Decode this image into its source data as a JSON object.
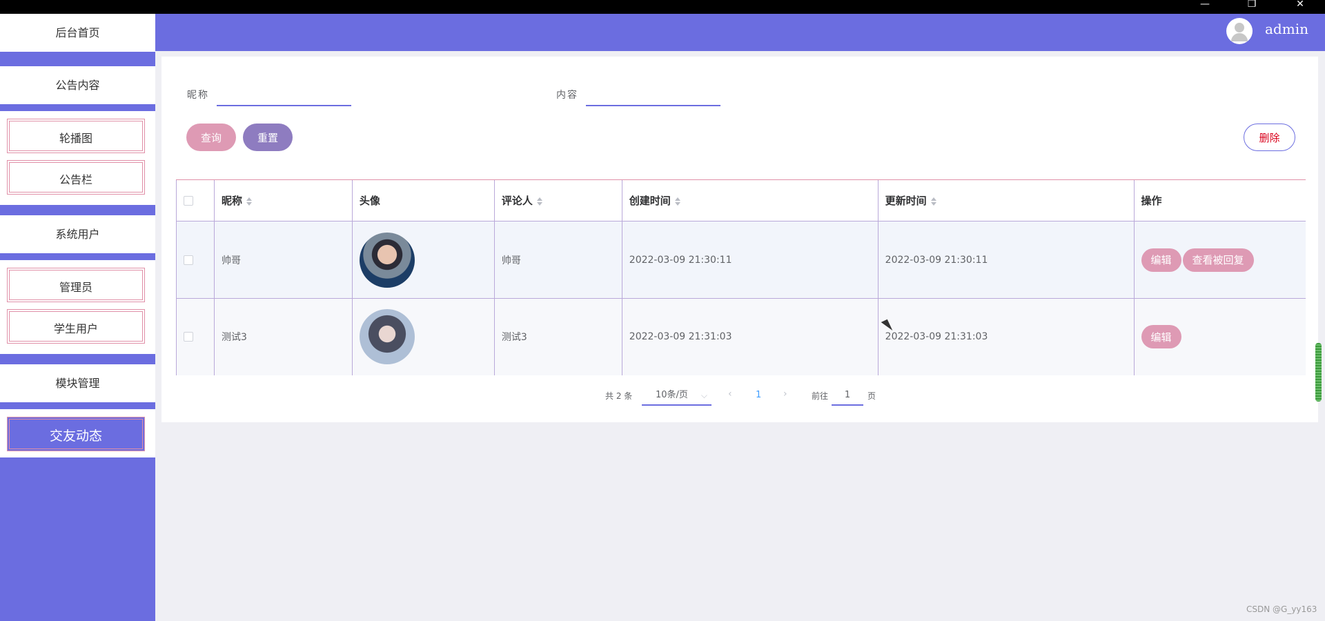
{
  "window": {
    "minimize_icon": "—",
    "maximize_icon": "❐",
    "close_icon": "✕"
  },
  "header": {
    "username": "admin",
    "avatar_icon": "user-avatar"
  },
  "sidebar": {
    "items": [
      {
        "label": "后台首页"
      },
      {
        "label": "公告内容"
      },
      {
        "label": "轮播图"
      },
      {
        "label": "公告栏"
      },
      {
        "label": "系统用户"
      },
      {
        "label": "管理员"
      },
      {
        "label": "学生用户"
      },
      {
        "label": "模块管理"
      },
      {
        "label": "交友动态"
      }
    ]
  },
  "search": {
    "nickname_label": "昵称",
    "nickname_value": "",
    "content_label": "内容",
    "content_value": "",
    "query_label": "查询",
    "reset_label": "重置",
    "delete_label": "删除"
  },
  "table": {
    "headers": [
      "昵称",
      "头像",
      "评论人",
      "创建时间",
      "更新时间",
      "操作"
    ],
    "rows": [
      {
        "nickname": "帅哥",
        "commenter": "帅哥",
        "created": "2022-03-09 21:30:11",
        "updated": "2022-03-09 21:30:11",
        "edit": "编辑",
        "view_reply": "查看被回复"
      },
      {
        "nickname": "测试3",
        "commenter": "测试3",
        "created": "2022-03-09 21:31:03",
        "updated": "2022-03-09 21:31:03",
        "edit": "编辑"
      }
    ]
  },
  "pagination": {
    "total_text": "共 2 条",
    "page_size": "10条/页",
    "current_page": "1",
    "goto_label": "前往",
    "goto_value": "1",
    "page_suffix": "页"
  },
  "watermark": "CSDN @G_yy163",
  "colors": {
    "accent": "#6b6de0",
    "pink": "#de9ab4",
    "purple": "#8e7cc0",
    "danger": "#d9001b"
  }
}
